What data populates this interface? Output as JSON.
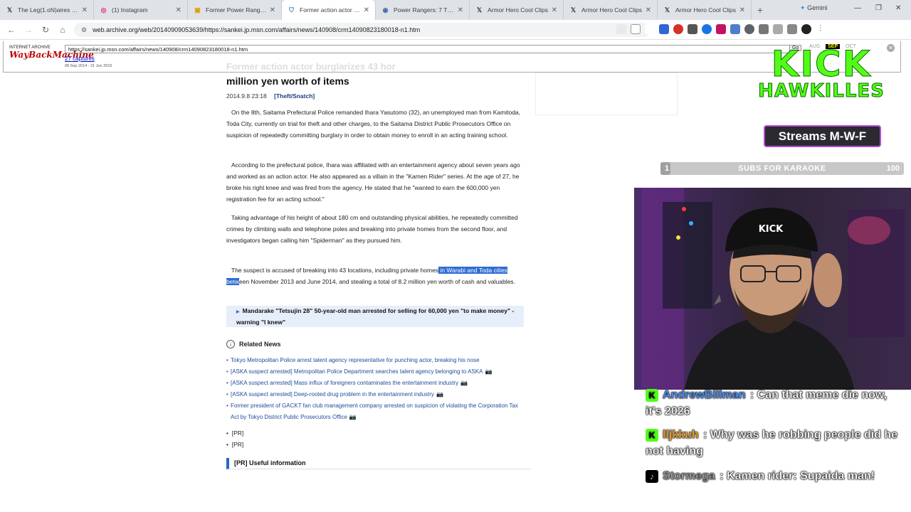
{
  "browser": {
    "tabs": [
      {
        "title": "The Leg(1.oN)aires on X",
        "icon": "x-icon"
      },
      {
        "title": "(1) Instagram",
        "icon": "instagram-icon"
      },
      {
        "title": "Former Power Ranger A",
        "icon": "page-icon"
      },
      {
        "title": "Former action actor bur",
        "icon": "wayback-icon",
        "active": true
      },
      {
        "title": "Power Rangers: 7 Thing",
        "icon": "page-icon"
      },
      {
        "title": "Armor Hero Cool Clips",
        "icon": "x-icon"
      },
      {
        "title": "Armor Hero Cool Clips",
        "icon": "x-icon"
      },
      {
        "title": "Armor Hero Cool Clips",
        "icon": "x-icon"
      }
    ],
    "gemini_label": "Gemini",
    "address": "web.archive.org/web/20140909053639/https://sankei.jp.msn.com/affairs/news/140908/crm14090823180018-n1.htm"
  },
  "wayback": {
    "logo_top": "INTERNET ARCHIVE",
    "logo_main": "WayBackMachine",
    "url": "https://sankei.jp.msn.com/affairs/news/140908/crm14090823180018-n1.htm",
    "captures": "27 captures",
    "range": "08 Sep 2014 - 21 Jun 2015",
    "go": "Go",
    "month_prev": "AUG",
    "month_cur": "SEP",
    "month_next": "OCT"
  },
  "article": {
    "faded_title": "Former action actor burglarizes 43 hor",
    "headline": "million yen worth of items",
    "date": "2014.9.8 23:18",
    "category": "[Theft/Snatch]",
    "p1": "On the 8th, Saitama Prefectural Police remanded Ihara Yasutomo (32), an unemployed man from Kamitoda, Toda City, currently on trial for theft and other charges, to the Saitama District Public Prosecutors Office on suspicion of repeatedly committing burglary in order to obtain money to enroll in an acting training school.",
    "p2": "According to the prefectural police, Ihara was affiliated with an entertainment agency about seven years ago and worked as an action actor. He also appeared as a villain in the \"Kamen Rider\" series. At the age of 27, he broke his right knee and was fired from the agency. He stated that he \"wanted to earn the 600,000 yen registration fee for an acting school.\"",
    "p3": "Taking advantage of his height of about 180 cm and outstanding physical abilities, he repeatedly committed crimes by climbing walls and telephone poles and breaking into private homes from the second floor, and investigators began calling him \"Spiderman\" as they pursued him.",
    "p4_before": "The suspect is accused of breaking into 43 locations, including private homes",
    "p4_highlight": " in Warabi and Toda cities betw",
    "p4_after": "een November 2013 and June 2014, and stealing a total of 8.2 million yen worth of cash and valuables.",
    "mandarake": "Mandarake \"Tetsujin 28\" 50-year-old man arrested for selling for 60,000 yen \"to make money\" - warning \"I knew\"",
    "related_heading": "Related News",
    "related": [
      {
        "text": "Tokyo Metropolitan Police arrest talent agency representative for punching actor, breaking his nose",
        "camera": false
      },
      {
        "text": "[ASKA suspect arrested] Metropolitan Police Department searches talent agency belonging to ASKA",
        "camera": true
      },
      {
        "text": "[ASKA suspect arrested] Mass influx of foreigners contaminates the entertainment industry",
        "camera": true
      },
      {
        "text": "[ASKA suspect arrested] Deep-rooted drug problem in the entertainment industry",
        "camera": true
      },
      {
        "text": "Former president of GACKT fan club management company arrested on suspicion of violating the Corporation Tax Act by Tokyo District Public Prosecutors Office",
        "camera": true
      }
    ],
    "pr1": "[PR]",
    "pr2": "[PR]",
    "useful": "[PR] Useful information"
  },
  "stream": {
    "logo_line1": "KICK",
    "logo_line2": "HAWKILLES",
    "schedule": "Streams M-W-F",
    "goal_current": "1",
    "goal_label": "SUBS FOR KARAOKE",
    "goal_target": "100",
    "goal_fraction": 0.01,
    "chat": [
      {
        "user": "AndrewBillman",
        "text": "Can that meme die now, it's 2026",
        "platform": "kick-icon",
        "color": "#4a90ff"
      },
      {
        "user": "lljkkuh",
        "text": "Why was he robbing people did he not having",
        "platform": "kick-icon",
        "color": "#f5a623"
      },
      {
        "user": "Stormega",
        "text": "Kamen rider: Supaida man!",
        "platform": "tiktok-icon",
        "color": "#9b9b9b"
      }
    ]
  }
}
